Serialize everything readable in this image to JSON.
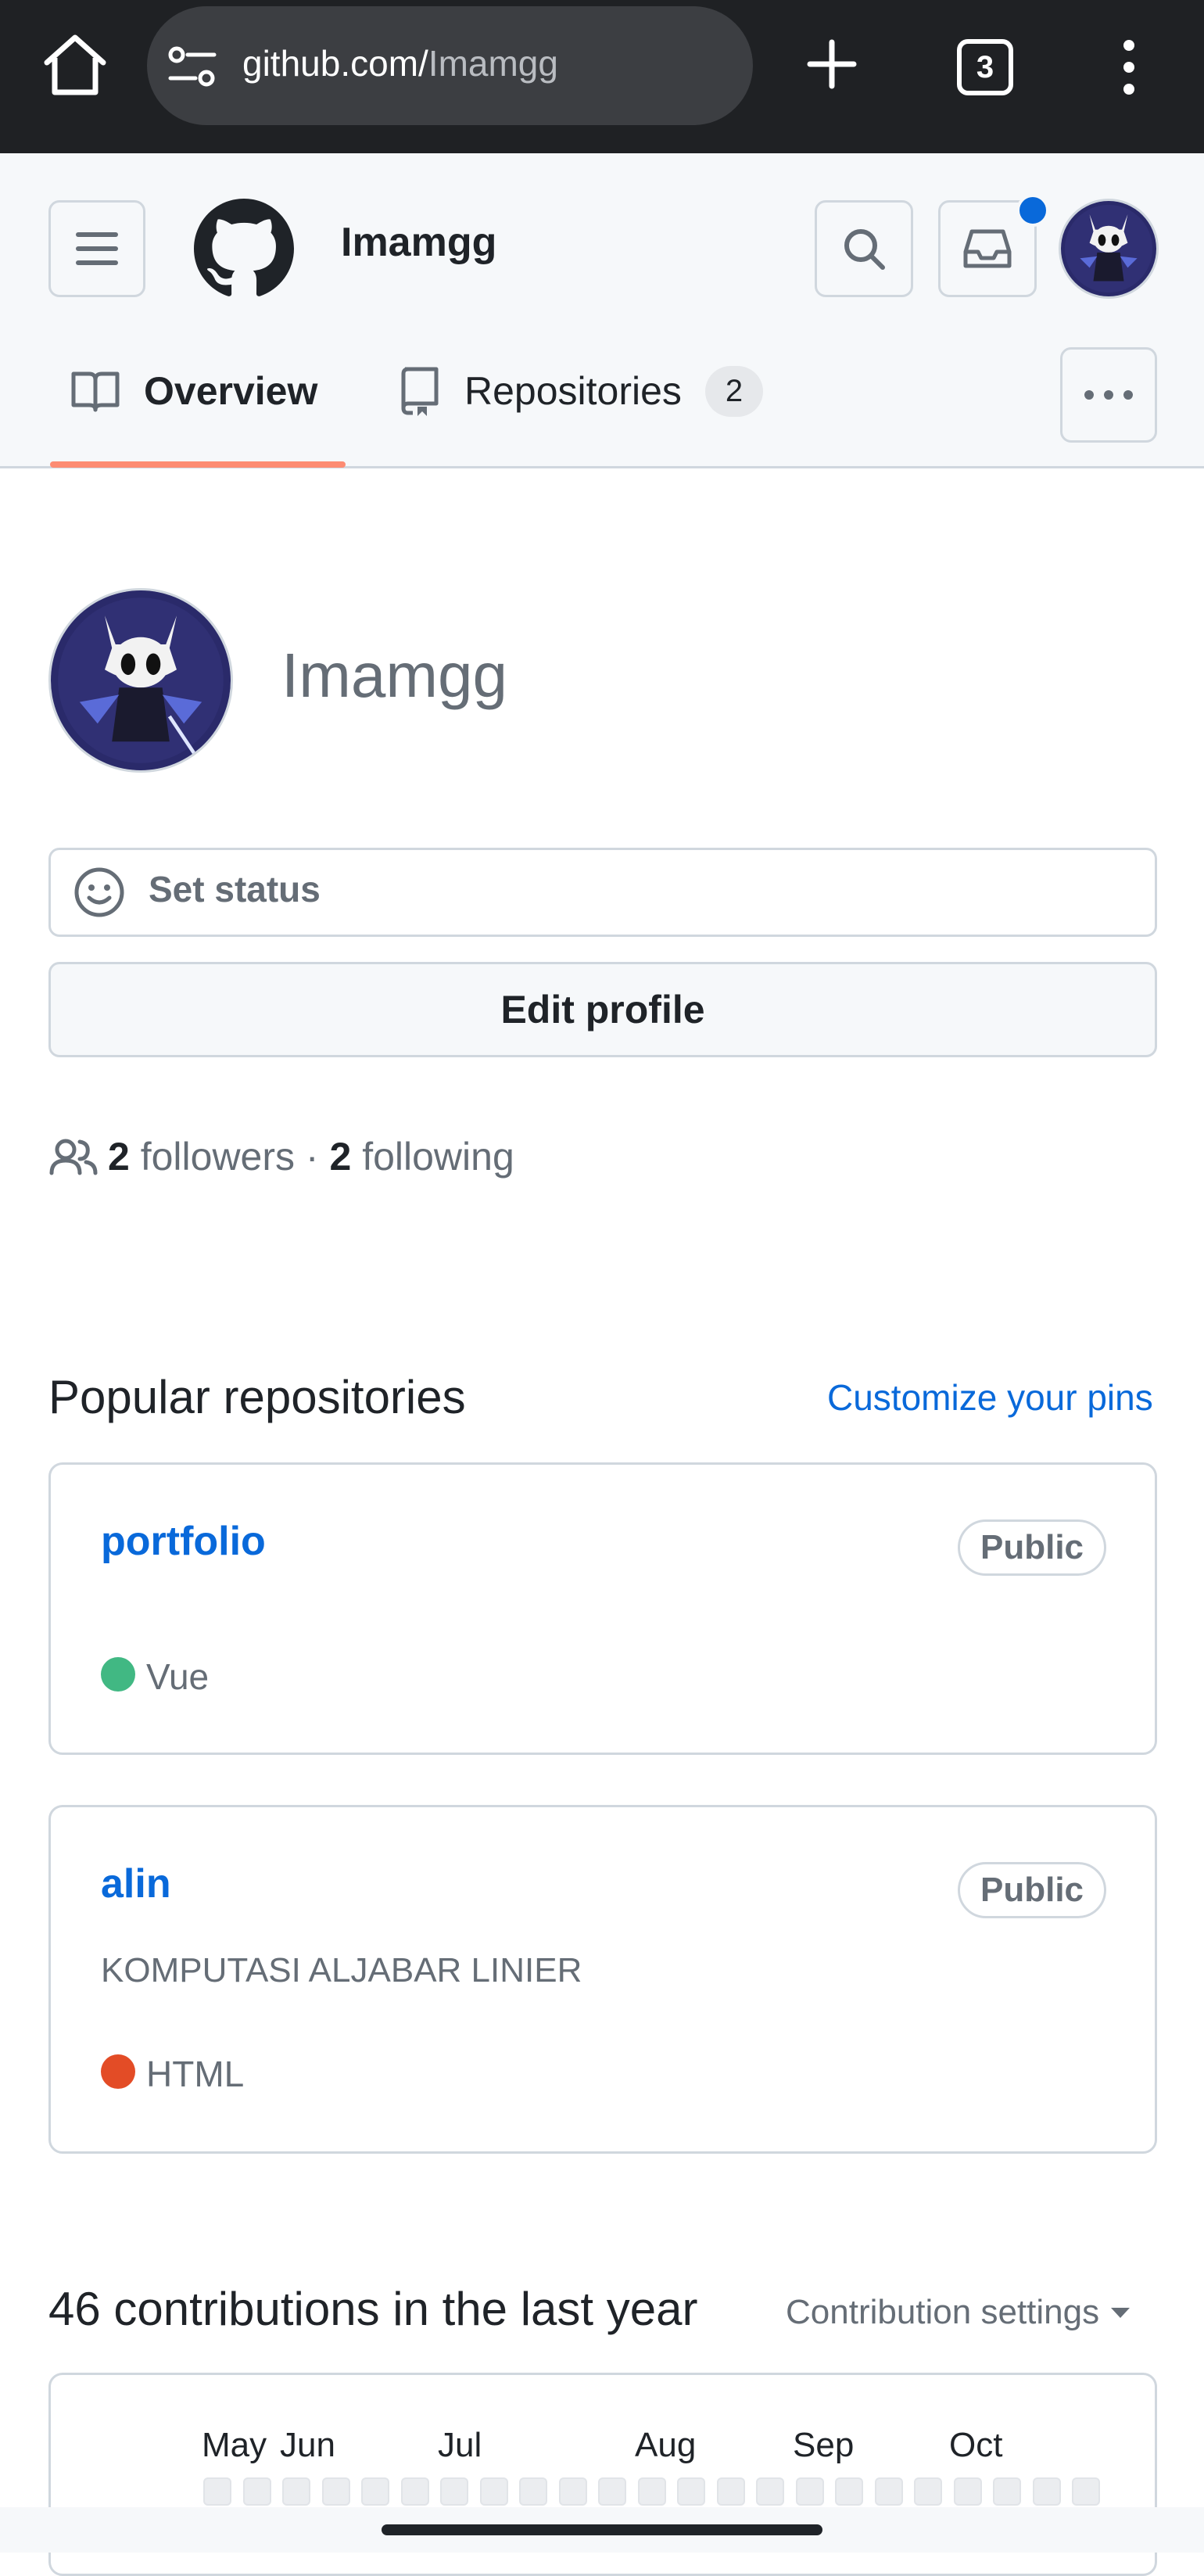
{
  "browser": {
    "url_domain": "github.com/",
    "url_path": "Imamgg",
    "tab_count": "3"
  },
  "header": {
    "username": "Imamgg",
    "notification_color": "#0969da"
  },
  "tabs": [
    {
      "label": "Overview",
      "active": true
    },
    {
      "label": "Repositories",
      "count": "2",
      "active": false
    }
  ],
  "profile": {
    "login": "Imamgg",
    "set_status_label": "Set status",
    "edit_profile_label": "Edit profile",
    "followers_count": "2",
    "followers_label": "followers",
    "separator": "·",
    "following_count": "2",
    "following_label": "following"
  },
  "popular": {
    "title": "Popular repositories",
    "customize_label": "Customize your pins",
    "repos": [
      {
        "name": "portfolio",
        "visibility": "Public",
        "description": "",
        "language": "Vue",
        "language_color": "#41b883"
      },
      {
        "name": "alin",
        "visibility": "Public",
        "description": "KOMPUTASI ALJABAR LINIER",
        "language": "HTML",
        "language_color": "#e34c26"
      }
    ]
  },
  "contributions": {
    "title": "46 contributions in the last year",
    "settings_label": "Contribution settings",
    "months": [
      "May",
      "Jun",
      "Jul",
      "Aug",
      "Sep",
      "Oct"
    ]
  },
  "colors": {
    "accent": "#0969da",
    "tab_underline": "#fd8c73",
    "browser_bar": "#1f2124"
  }
}
